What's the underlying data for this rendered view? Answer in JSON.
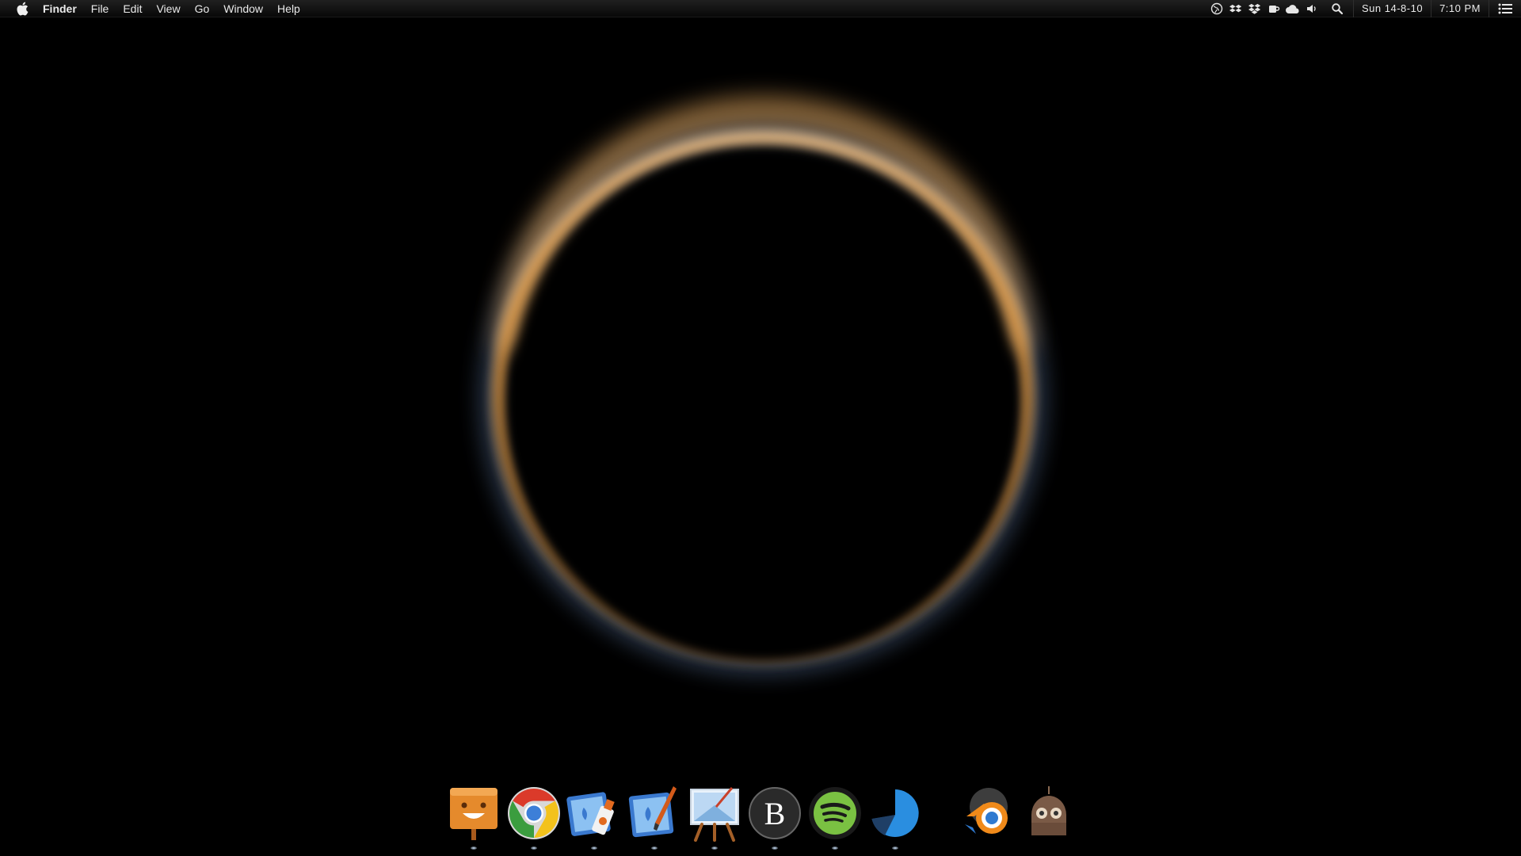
{
  "menubar": {
    "app_name": "Finder",
    "menus": [
      "File",
      "Edit",
      "View",
      "Go",
      "Window",
      "Help"
    ],
    "status_icons": [
      "globe-icon",
      "dropbox-icon",
      "dropbox-icon",
      "coffee-cup-icon",
      "cloud-icon",
      "volume-icon",
      "search-icon"
    ],
    "date": "Sun 14-8-10",
    "time": "7:10 PM"
  },
  "wallpaper": {
    "subject": "eclipse-ring",
    "ring_colors": {
      "orange": "#e8a55a",
      "blue": "#8fb6e8"
    }
  },
  "dock": {
    "items": [
      {
        "name": "stickies-app-icon",
        "running": true
      },
      {
        "name": "chrome-app-icon",
        "running": true
      },
      {
        "name": "photo-glue-app-icon",
        "running": true
      },
      {
        "name": "photo-brush-app-icon",
        "running": true
      },
      {
        "name": "keynote-easel-app-icon",
        "running": true
      },
      {
        "name": "b-letter-app-icon",
        "running": true
      },
      {
        "name": "spotify-app-icon",
        "running": true
      },
      {
        "name": "pie-chart-app-icon",
        "running": true
      },
      {
        "name": "blender-app-icon",
        "running": false
      },
      {
        "name": "robot-app-icon",
        "running": false
      }
    ]
  }
}
